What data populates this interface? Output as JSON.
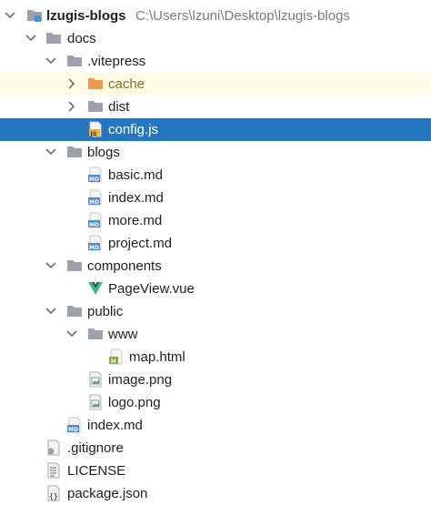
{
  "colors": {
    "selection": "#2675bf",
    "excluded_background": "#fdfbe6",
    "excluded_text": "#8a6d25",
    "folder_gray": "#9aa3ab",
    "folder_orange": "#ee9a4d",
    "vue_green": "#41b883"
  },
  "tree": {
    "root": {
      "label": "lzugis-blogs",
      "path": "C:\\Users\\lzuni\\Desktop\\lzugis-blogs",
      "icon": "module-folder-icon",
      "state": "expanded"
    },
    "docs": {
      "label": "docs",
      "icon": "folder-icon",
      "state": "expanded"
    },
    "vitepress": {
      "label": ".vitepress",
      "icon": "folder-icon",
      "state": "expanded"
    },
    "cache": {
      "label": "cache",
      "icon": "excluded-folder-icon",
      "state": "collapsed"
    },
    "dist": {
      "label": "dist",
      "icon": "folder-icon",
      "state": "collapsed"
    },
    "config_js": {
      "label": "config.js",
      "icon": "js-file-icon",
      "selected": true
    },
    "blogs": {
      "label": "blogs",
      "icon": "folder-icon",
      "state": "expanded"
    },
    "basic_md": {
      "label": "basic.md",
      "icon": "md-file-icon"
    },
    "blogs_index_md": {
      "label": "index.md",
      "icon": "md-file-icon"
    },
    "more_md": {
      "label": "more.md",
      "icon": "md-file-icon"
    },
    "project_md": {
      "label": "project.md",
      "icon": "md-file-icon"
    },
    "components": {
      "label": "components",
      "icon": "folder-icon",
      "state": "expanded"
    },
    "pageview_vue": {
      "label": "PageView.vue",
      "icon": "vue-file-icon"
    },
    "public": {
      "label": "public",
      "icon": "folder-icon",
      "state": "expanded"
    },
    "www": {
      "label": "www",
      "icon": "folder-icon",
      "state": "expanded"
    },
    "map_html": {
      "label": "map.html",
      "icon": "html-file-icon"
    },
    "image_png": {
      "label": "image.png",
      "icon": "image-file-icon"
    },
    "logo_png": {
      "label": "logo.png",
      "icon": "image-file-icon"
    },
    "docs_index_md": {
      "label": "index.md",
      "icon": "md-file-icon"
    },
    "gitignore": {
      "label": ".gitignore",
      "icon": "gitignore-file-icon"
    },
    "license": {
      "label": "LICENSE",
      "icon": "text-file-icon"
    },
    "package_json": {
      "label": "package.json",
      "icon": "json-file-icon"
    }
  }
}
